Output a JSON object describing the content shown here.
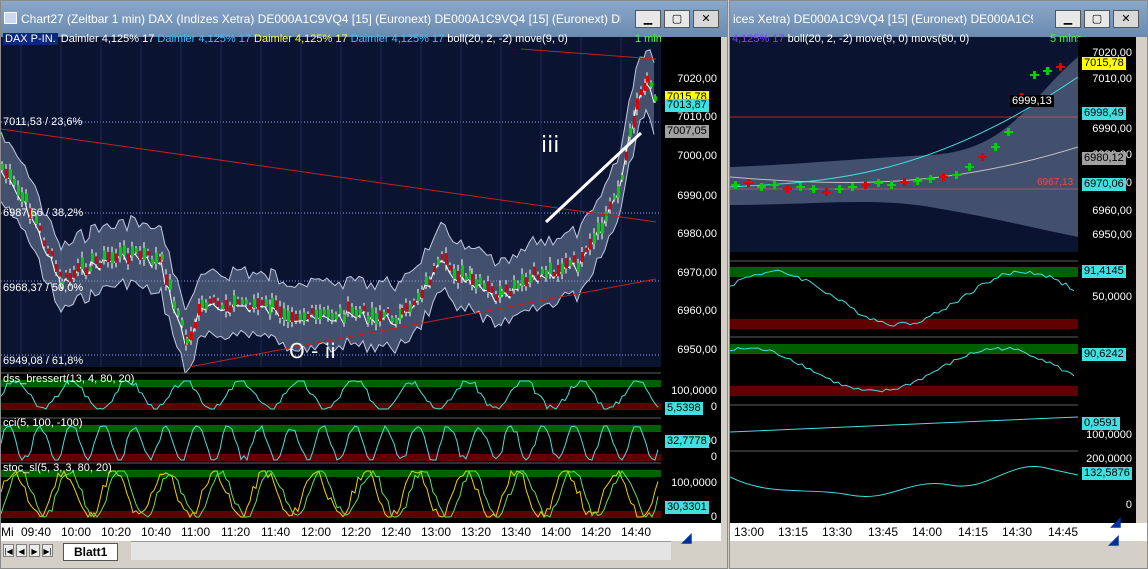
{
  "left_window": {
    "title": "Chart27 (Zeitbar 1 min)  DAX (Indizes Xetra)  DE000A1C9VQ4 [15] (Euronext)  DE000A1C9VQ4 [15] (Euronext)  DE000...",
    "legend": {
      "dax": "DAX P-IN.",
      "d1": "Daimler  4,125% 17",
      "d2": "Daimler  4,125% 17",
      "d3": "Daimler  4,125% 17",
      "d4": "Daimler  4,125% 17",
      "boll": "boll(20, 2, -2)  move(9, 0)",
      "interval": "1 min"
    },
    "fib_labels": [
      "7011,53 / 23,6%",
      "6987,66 / 38,2%",
      "6968,37 / 50,0%",
      "6949,08 / 61,8%"
    ],
    "price_scale": [
      "7020,00",
      "7010,00",
      "7000,00",
      "6990,00",
      "6980,00",
      "6970,00",
      "6960,00",
      "6950,00"
    ],
    "price_boxes": [
      "7015,78",
      "7013,87",
      "7007,05"
    ],
    "indicators": [
      {
        "name": "dss_bressert(13, 4, 80, 20)",
        "scale": [
          "100,0000",
          "0"
        ],
        "value": "5,5398"
      },
      {
        "name": "cci(5, 100, -100)",
        "scale": [
          "100,0000",
          "0"
        ],
        "value": "32,7778"
      },
      {
        "name": "stoc_sl(5, 3, 3, 80, 20)",
        "scale": [
          "100,0000",
          "0"
        ],
        "value": "30,3301"
      }
    ],
    "annotations": {
      "wave_up": "iii",
      "wave_low": "O - ii"
    },
    "time_axis": [
      "Mi",
      "09:40",
      "10:00",
      "10:20",
      "10:40",
      "11:00",
      "11:20",
      "11:40",
      "12:00",
      "12:20",
      "12:40",
      "13:00",
      "13:20",
      "13:40",
      "14:00",
      "14:20",
      "14:40"
    ],
    "sheet_tab": "Blatt1"
  },
  "right_window": {
    "title": "ices Xetra)  DE000A1C9VQ4 [15] (Euronext)  DE000A1C9VQ4 ...",
    "legend": {
      "pre": "4,125% 17",
      "boll": "boll(20, 2, -2)  move(9, 0)  movs(60, 0)",
      "interval": "5 mins"
    },
    "price_scale": [
      "7020,00",
      "7010,00",
      "7000,00",
      "6990,00",
      "6980,00",
      "6970,00",
      "6960,00",
      "6950,00"
    ],
    "price_boxes": [
      "7015,78",
      "6999,13",
      "6998,49",
      "6980,12",
      "6970,06"
    ],
    "hline_label": "6967,13",
    "indicators": [
      {
        "scale": [
          "50,0000"
        ],
        "value": "91,4145"
      },
      {
        "scale": [],
        "value": "90,6242"
      },
      {
        "scale": [
          "100,0000"
        ],
        "value": "0,9591"
      },
      {
        "scale": [
          "200,0000",
          "0"
        ],
        "value": "132,5876"
      }
    ],
    "time_axis": [
      "13:00",
      "13:15",
      "13:30",
      "13:45",
      "14:00",
      "14:15",
      "14:30",
      "14:45"
    ]
  },
  "colors": {
    "title_bar": "#6a8ab0",
    "chart_bg": "#000000",
    "up_candle": "#00d000",
    "down_candle": "#e00000",
    "band_fill": "#8a9ab8",
    "indicator_line": "#40e0e0",
    "stoch_line": "#f0d000",
    "overbought_band": "#006000",
    "oversold_band": "#600000",
    "fib_line": "#8080ff",
    "trend_line": "#c02020"
  },
  "icons": [
    "window-system-icon",
    "minimize-icon",
    "maximize-icon",
    "close-icon",
    "first-sheet-icon",
    "prev-sheet-icon",
    "next-sheet-icon",
    "last-sheet-icon",
    "draw-tool-icon"
  ]
}
